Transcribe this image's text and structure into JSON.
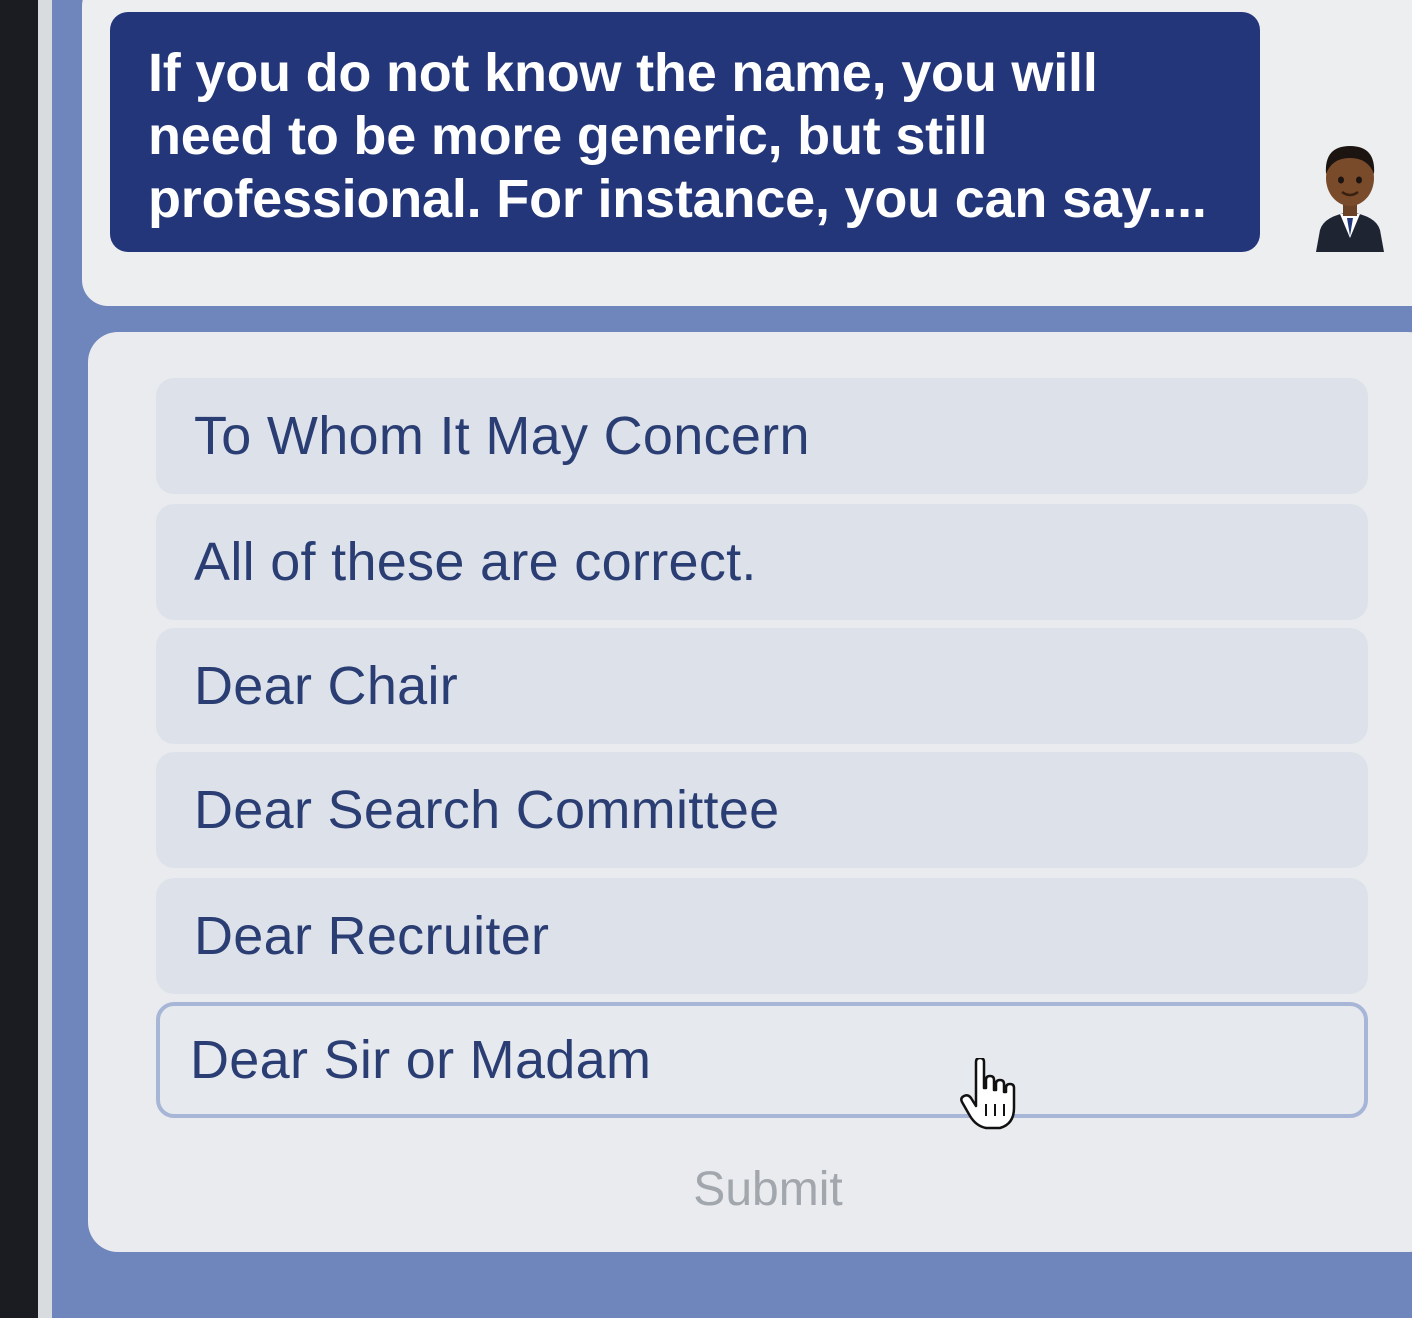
{
  "prompt": {
    "text": "If you do not know the name, you will need to be more generic, but still professional. For instance, you can say...."
  },
  "avatar": {
    "icon": "tutor-avatar-icon"
  },
  "options": [
    {
      "label": "To Whom It May Concern",
      "selected": false
    },
    {
      "label": "All of these are correct.",
      "selected": false
    },
    {
      "label": "Dear Chair",
      "selected": false
    },
    {
      "label": "Dear Search Committee",
      "selected": false
    },
    {
      "label": "Dear Recruiter",
      "selected": false
    },
    {
      "label": "Dear Sir or Madam",
      "selected": true
    }
  ],
  "submit": {
    "label": "Submit",
    "enabled": false
  },
  "colors": {
    "bubble": "#233679",
    "option_text": "#2b3e74",
    "background": "#6f86bd",
    "submit_disabled": "#a2a6ad"
  }
}
